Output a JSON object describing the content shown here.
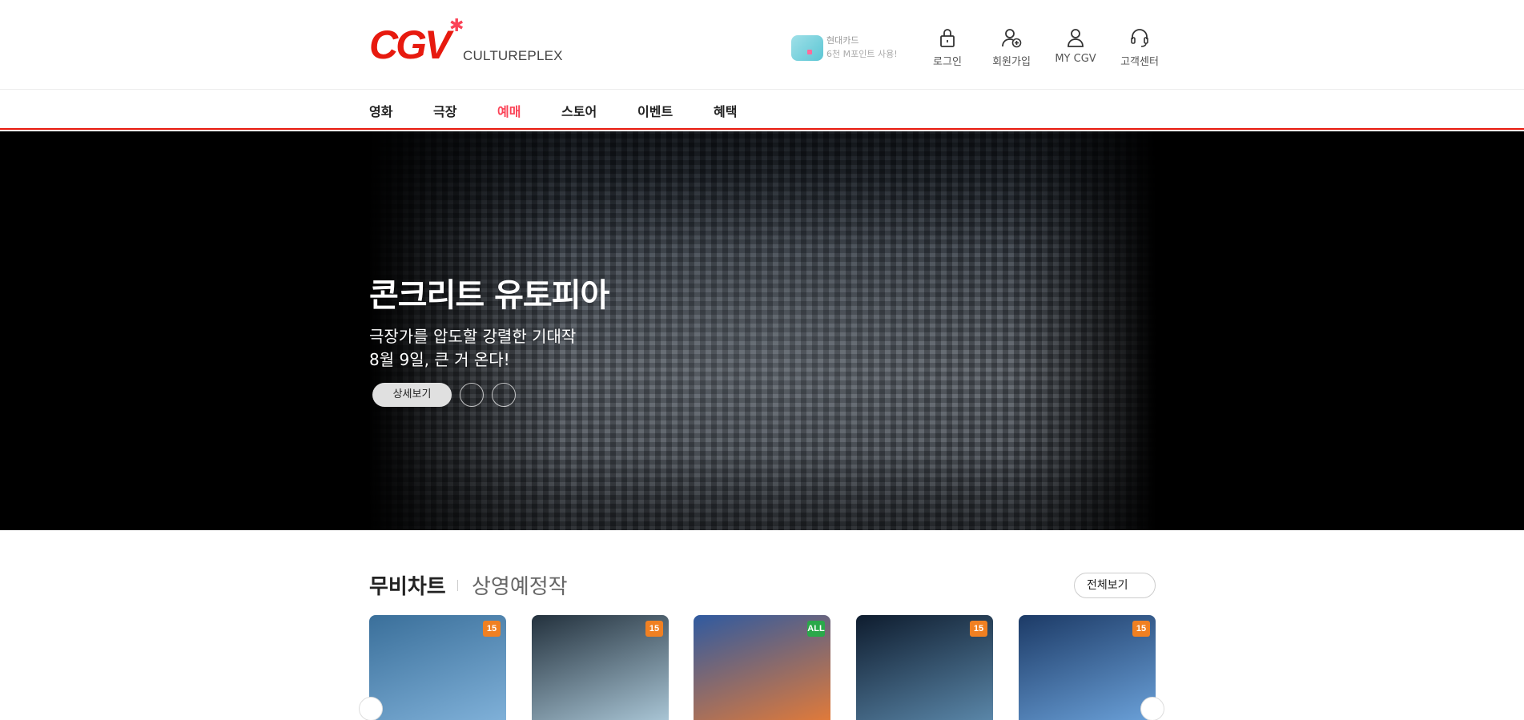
{
  "header": {
    "logo_text": "CGV",
    "logo_star": "✱",
    "culture": "CULTUREPLEX",
    "promo": {
      "line1": "현대카드",
      "line2": "6천 M포인트 사용!"
    },
    "utils": [
      {
        "label": "로그인",
        "icon": "lock-icon"
      },
      {
        "label": "회원가입",
        "icon": "user-add-icon"
      },
      {
        "label": "MY CGV",
        "icon": "user-icon"
      },
      {
        "label": "고객센터",
        "icon": "headset-icon"
      }
    ]
  },
  "nav": {
    "items": [
      "영화",
      "극장",
      "예매",
      "스토어",
      "이벤트",
      "혜택"
    ],
    "active_index": 2
  },
  "hero": {
    "title": "콘크리트 유토피아",
    "sub1": "극장가를 압도할 강렬한 기대작",
    "sub2": "8월 9일, 큰 거 온다!",
    "detail_button": "상세보기"
  },
  "movie_chart": {
    "title": "무비차트",
    "upcoming": "상영예정작",
    "view_all": "전체보기",
    "posters": [
      {
        "rating": "15",
        "rating_color": "#f08022",
        "colors": [
          "#3a6f9a",
          "#7fb0d8"
        ]
      },
      {
        "rating": "15",
        "rating_color": "#f08022",
        "colors": [
          "#23313d",
          "#a8c4d4"
        ]
      },
      {
        "rating": "ALL",
        "rating_color": "#2aa84a",
        "colors": [
          "#2f5aa0",
          "#e07a3a"
        ]
      },
      {
        "rating": "15",
        "rating_color": "#f08022",
        "colors": [
          "#0e1c2e",
          "#5a86a8"
        ]
      },
      {
        "rating": "15",
        "rating_color": "#f08022",
        "colors": [
          "#1c3a66",
          "#6aa0d8"
        ]
      }
    ]
  },
  "colors": {
    "brand": "#e71a0f",
    "active_nav": "#fb4357"
  }
}
